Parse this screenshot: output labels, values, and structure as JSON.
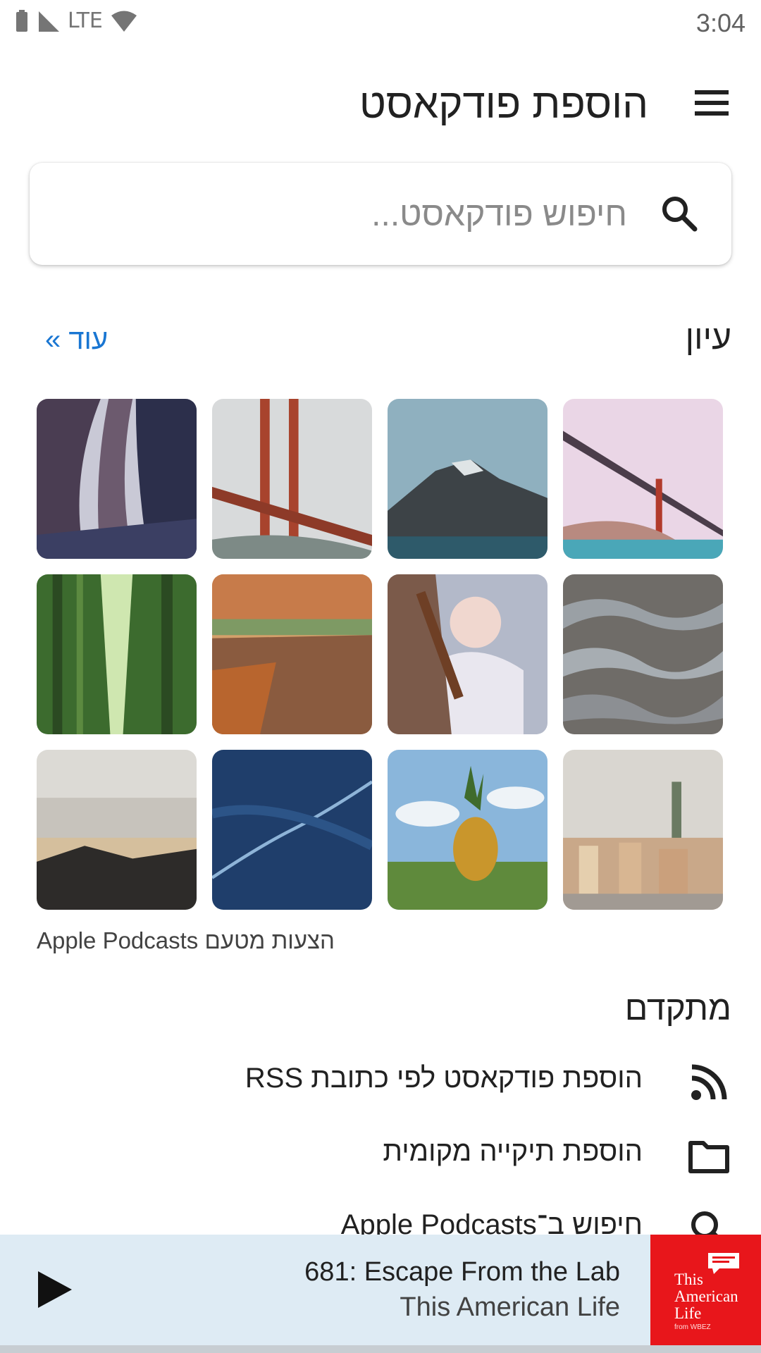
{
  "status_bar": {
    "network": "LTE",
    "time": "3:04"
  },
  "toolbar": {
    "title": "הוספת פודקאסט"
  },
  "search": {
    "placeholder": "חיפוש פודקאסט..."
  },
  "discover": {
    "title": "עיון",
    "more_label": "עוד »",
    "caption": "הצעות מטעם Apple Podcasts",
    "tiles": [
      "library-shelves",
      "golden-gate-fog",
      "mountain-lake",
      "golden-gate-bay",
      "bamboo-forest",
      "autumn-path",
      "baby",
      "water-ripples",
      "rocky-beach",
      "ocean-wave",
      "pineapple-field",
      "stockholm-city"
    ]
  },
  "advanced": {
    "title": "מתקדם",
    "items": [
      {
        "label": "הוספת פודקאסט לפי כתובת RSS",
        "icon": "rss-icon"
      },
      {
        "label": "הוספת תיקייה מקומית",
        "icon": "folder-icon"
      },
      {
        "label": "חיפוש ב־Apple Podcasts",
        "icon": "search-icon"
      }
    ]
  },
  "player": {
    "episode": "681: Escape From the Lab",
    "show": "This American Life",
    "art_text": "This American Life",
    "art_small": "from WBEZ"
  },
  "colors": {
    "accent": "#1976d2",
    "player_bg": "#deebf4",
    "art_red": "#e8161b"
  }
}
